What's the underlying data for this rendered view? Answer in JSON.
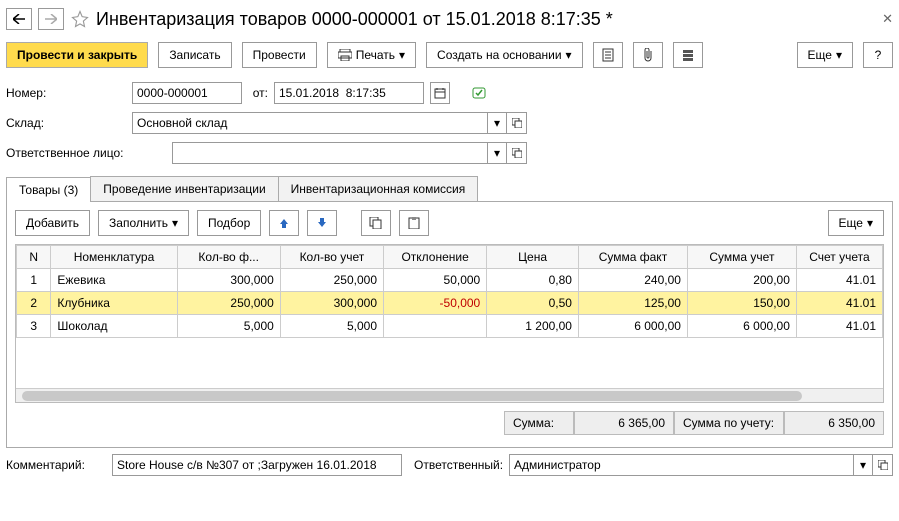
{
  "titlebar": {
    "title": "Инвентаризация товаров 0000-000001 от 15.01.2018 8:17:35 *"
  },
  "toolbar": {
    "post_close": "Провести и закрыть",
    "save": "Записать",
    "post": "Провести",
    "print": "Печать",
    "create_based": "Создать на основании",
    "more": "Еще"
  },
  "form": {
    "number_label": "Номер:",
    "number_value": "0000-000001",
    "from_label": "от:",
    "date_value": "15.01.2018  8:17:35",
    "warehouse_label": "Склад:",
    "warehouse_value": "Основной склад",
    "responsible_label": "Ответственное лицо:",
    "responsible_value": ""
  },
  "tabs": {
    "goods": "Товары (3)",
    "conduct": "Проведение инвентаризации",
    "commission": "Инвентаризационная комиссия"
  },
  "subtoolbar": {
    "add": "Добавить",
    "fill": "Заполнить",
    "pick": "Подбор",
    "more": "Еще"
  },
  "grid": {
    "headers": {
      "n": "N",
      "nomen": "Номенклатура",
      "qty_fact": "Кол-во ф...",
      "qty_acc": "Кол-во учет",
      "deviation": "Отклонение",
      "price": "Цена",
      "sum_fact": "Сумма факт",
      "sum_acc": "Сумма учет",
      "account": "Счет учета"
    },
    "rows": [
      {
        "n": "1",
        "nomen": "Ежевика",
        "qf": "300,000",
        "qa": "250,000",
        "dev": "50,000",
        "price": "0,80",
        "sf": "240,00",
        "sa": "200,00",
        "acc": "41.01",
        "sel": false
      },
      {
        "n": "2",
        "nomen": "Клубника",
        "qf": "250,000",
        "qa": "300,000",
        "dev": "-50,000",
        "price": "0,50",
        "sf": "125,00",
        "sa": "150,00",
        "acc": "41.01",
        "sel": true
      },
      {
        "n": "3",
        "nomen": "Шоколад",
        "qf": "5,000",
        "qa": "5,000",
        "dev": "",
        "price": "1 200,00",
        "sf": "6 000,00",
        "sa": "6 000,00",
        "acc": "41.01",
        "sel": false
      }
    ]
  },
  "totals": {
    "sum_label": "Сумма:",
    "sum_value": "6 365,00",
    "sum_acc_label": "Сумма по учету:",
    "sum_acc_value": "6 350,00"
  },
  "bottom": {
    "comment_label": "Комментарий:",
    "comment_value": "Store House с/в №307 от ;Загружен 16.01.2018",
    "resp_label": "Ответственный:",
    "resp_value": "Администратор"
  }
}
